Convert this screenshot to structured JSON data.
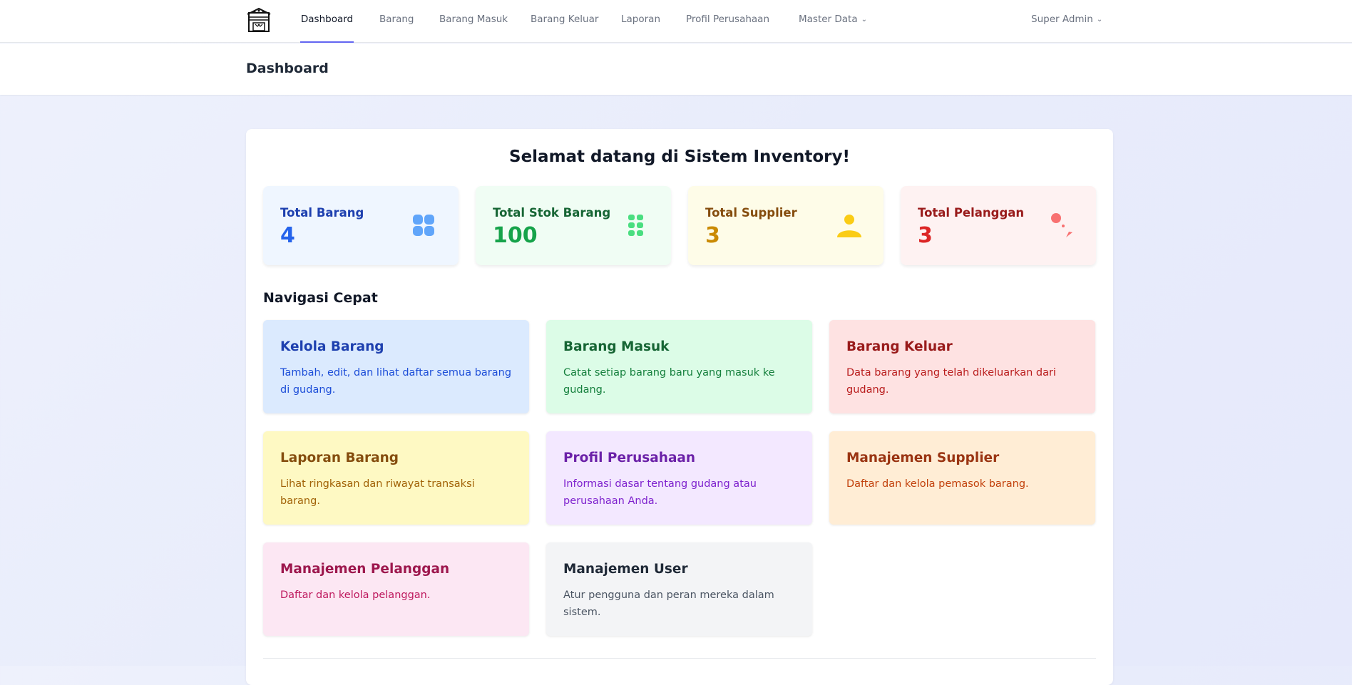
{
  "nav": {
    "items": [
      {
        "label": "Dashboard",
        "active": true
      },
      {
        "label": "Barang"
      },
      {
        "label": "Barang Masuk"
      },
      {
        "label": "Barang Keluar"
      },
      {
        "label": "Laporan"
      },
      {
        "label": "Profil Perusahaan"
      }
    ],
    "master_data": "Master Data",
    "user": "Super Admin"
  },
  "header": {
    "title": "Dashboard"
  },
  "main": {
    "welcome": "Selamat datang di Sistem Inventory!",
    "stats": [
      {
        "label": "Total Barang",
        "value": "4",
        "icon": "grid-icon",
        "color": "#1e40af",
        "value_color": "#2563eb",
        "bg": "#eff6ff"
      },
      {
        "label": "Total Stok Barang",
        "value": "100",
        "icon": "list-grid-icon",
        "color": "#166534",
        "value_color": "#16a34a",
        "bg": "#f0fdf4"
      },
      {
        "label": "Total Supplier",
        "value": "3",
        "icon": "user-icon",
        "color": "#854d0e",
        "value_color": "#ca8a04",
        "bg": "#fefce8"
      },
      {
        "label": "Total Pelanggan",
        "value": "3",
        "icon": "customer-icon",
        "color": "#991b1b",
        "value_color": "#dc2626",
        "bg": "#fef2f2"
      }
    ],
    "quick_nav_title": "Navigasi Cepat",
    "quick_nav": [
      {
        "title": "Kelola Barang",
        "desc": "Tambah, edit, dan lihat daftar semua barang di gudang.",
        "bg": "#dbeafe",
        "color": "#1e40af",
        "desc_color": "#1d4ed8"
      },
      {
        "title": "Barang Masuk",
        "desc": "Catat setiap barang baru yang masuk ke gudang.",
        "bg": "#dcfce7",
        "color": "#166534",
        "desc_color": "#15803d"
      },
      {
        "title": "Barang Keluar",
        "desc": "Data barang yang telah dikeluarkan dari gudang.",
        "bg": "#fee2e2",
        "color": "#991b1b",
        "desc_color": "#b91c1c"
      },
      {
        "title": "Laporan Barang",
        "desc": "Lihat ringkasan dan riwayat transaksi barang.",
        "bg": "#fef9c3",
        "color": "#854d0e",
        "desc_color": "#a16207"
      },
      {
        "title": "Profil Perusahaan",
        "desc": "Informasi dasar tentang gudang atau perusahaan Anda.",
        "bg": "#f3e8ff",
        "color": "#6b21a8",
        "desc_color": "#7e22ce"
      },
      {
        "title": "Manajemen Supplier",
        "desc": "Daftar dan kelola pemasok barang.",
        "bg": "#ffedd5",
        "color": "#9a3412",
        "desc_color": "#c2410c"
      },
      {
        "title": "Manajemen Pelanggan",
        "desc": "Daftar dan kelola pelanggan.",
        "bg": "#fce7f3",
        "color": "#9d174d",
        "desc_color": "#be185d"
      },
      {
        "title": "Manajemen User",
        "desc": "Atur pengguna dan peran mereka dalam sistem.",
        "bg": "#f3f4f6",
        "color": "#1f2937",
        "desc_color": "#4b5563"
      }
    ]
  }
}
